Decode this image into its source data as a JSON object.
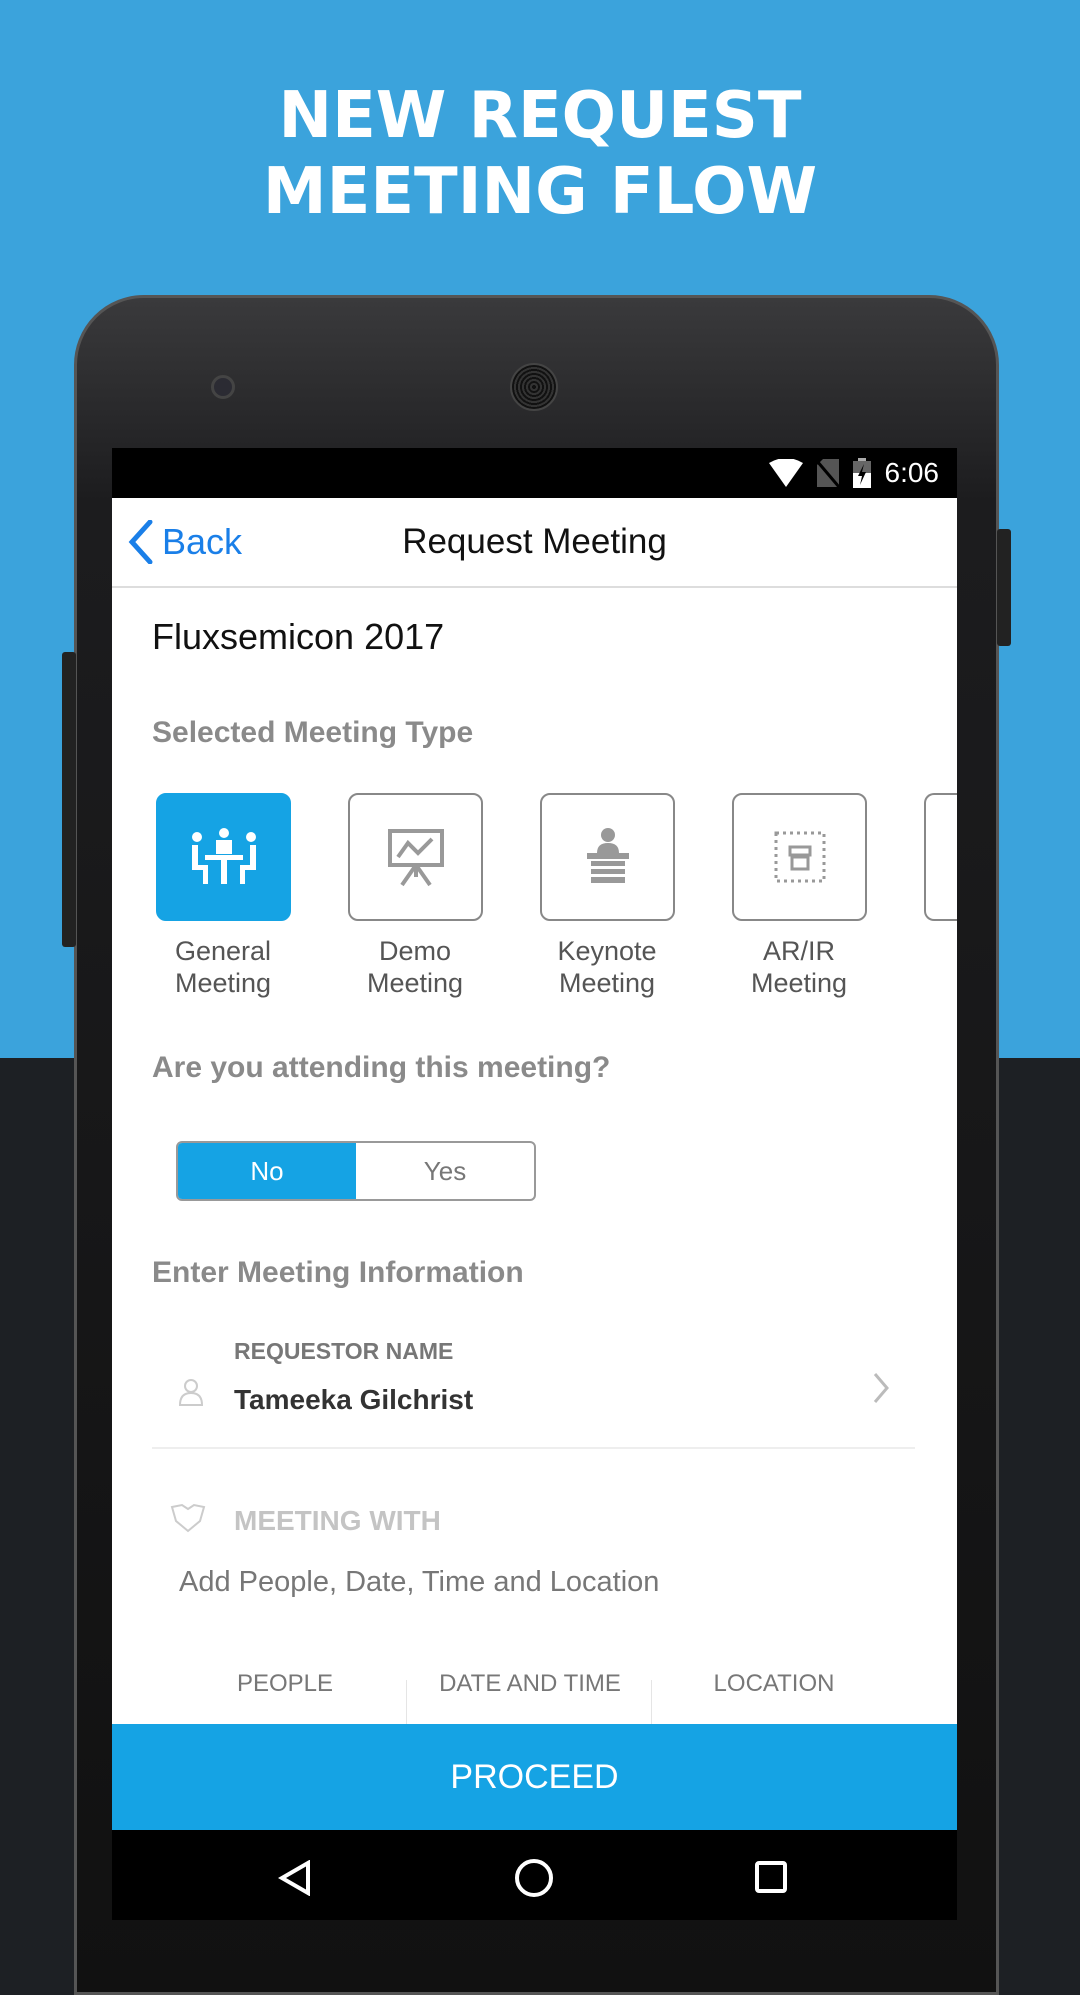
{
  "headline": {
    "line1": "NEW REQUEST",
    "line2": "MEETING FLOW"
  },
  "status_bar": {
    "time": "6:06",
    "icons": [
      "wifi-icon",
      "no-sim-icon",
      "battery-charging-icon"
    ]
  },
  "app_bar": {
    "back_label": "Back",
    "title": "Request Meeting"
  },
  "event_name": "Fluxsemicon 2017",
  "meeting_type": {
    "heading": "Selected Meeting Type",
    "options": [
      {
        "line1": "General",
        "line2": "Meeting",
        "icon": "people-at-table-icon",
        "selected": true
      },
      {
        "line1": "Demo",
        "line2": "Meeting",
        "icon": "presentation-board-icon",
        "selected": false
      },
      {
        "line1": "Keynote",
        "line2": "Meeting",
        "icon": "podium-speaker-icon",
        "selected": false
      },
      {
        "line1": "AR/IR",
        "line2": "Meeting",
        "icon": "analyst-exchange-icon",
        "selected": false
      }
    ]
  },
  "attending": {
    "question": "Are you attending this meeting?",
    "options": [
      "No",
      "Yes"
    ],
    "selected": "No"
  },
  "meeting_info": {
    "heading": "Enter Meeting Information",
    "requestor_label": "REQUESTOR NAME",
    "requestor_value": "Tameeka Gilchrist",
    "meeting_with_label": "MEETING WITH",
    "meeting_with_hint": "Add People, Date, Time and Location",
    "tabs": [
      "PEOPLE",
      "DATE AND TIME",
      "LOCATION"
    ]
  },
  "proceed_label": "PROCEED",
  "colors": {
    "accent": "#15a3e4",
    "background": "#3ba3dc",
    "link": "#1a7fe8"
  }
}
